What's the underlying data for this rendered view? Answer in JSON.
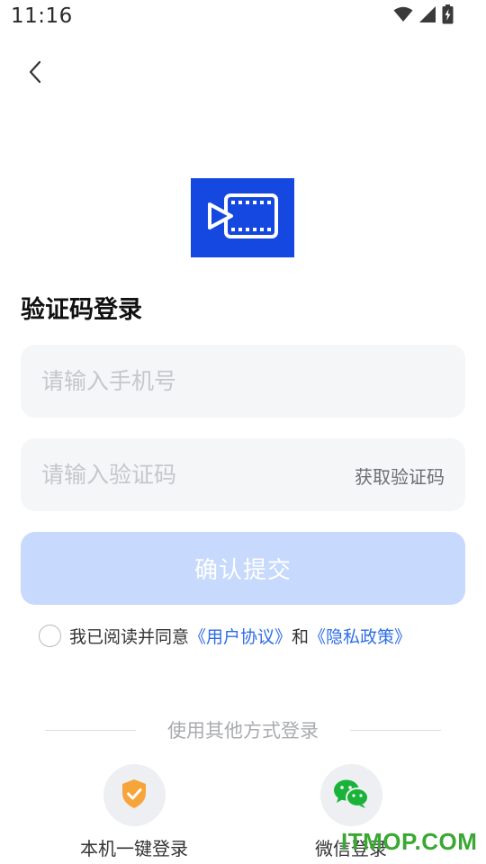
{
  "status_bar": {
    "time": "11:16",
    "icons": [
      "wifi-icon",
      "cell-signal-icon",
      "battery-charging-icon"
    ]
  },
  "nav": {
    "back_icon": "chevron-left-icon"
  },
  "logo": {
    "icon": "video-play-icon",
    "bg_color": "#1448e0"
  },
  "title": "验证码登录",
  "phone": {
    "placeholder": "请输入手机号",
    "value": ""
  },
  "code": {
    "placeholder": "请输入验证码",
    "value": "",
    "get_code_label": "获取验证码"
  },
  "submit": {
    "label": "确认提交",
    "color": "#c7d9fc"
  },
  "agreement": {
    "prefix": "我已阅读并同意",
    "user_agreement": "《用户协议》",
    "conjunction": "和",
    "privacy_policy": "《隐私政策》",
    "link_color": "#2e6de6",
    "checked": false
  },
  "alt_login": {
    "divider_text": "使用其他方式登录",
    "options": [
      {
        "label": "本机一键登录",
        "icon": "shield-check-icon"
      },
      {
        "label": "微信登录",
        "icon": "wechat-icon"
      }
    ]
  },
  "watermark": "ITMOP.COM"
}
